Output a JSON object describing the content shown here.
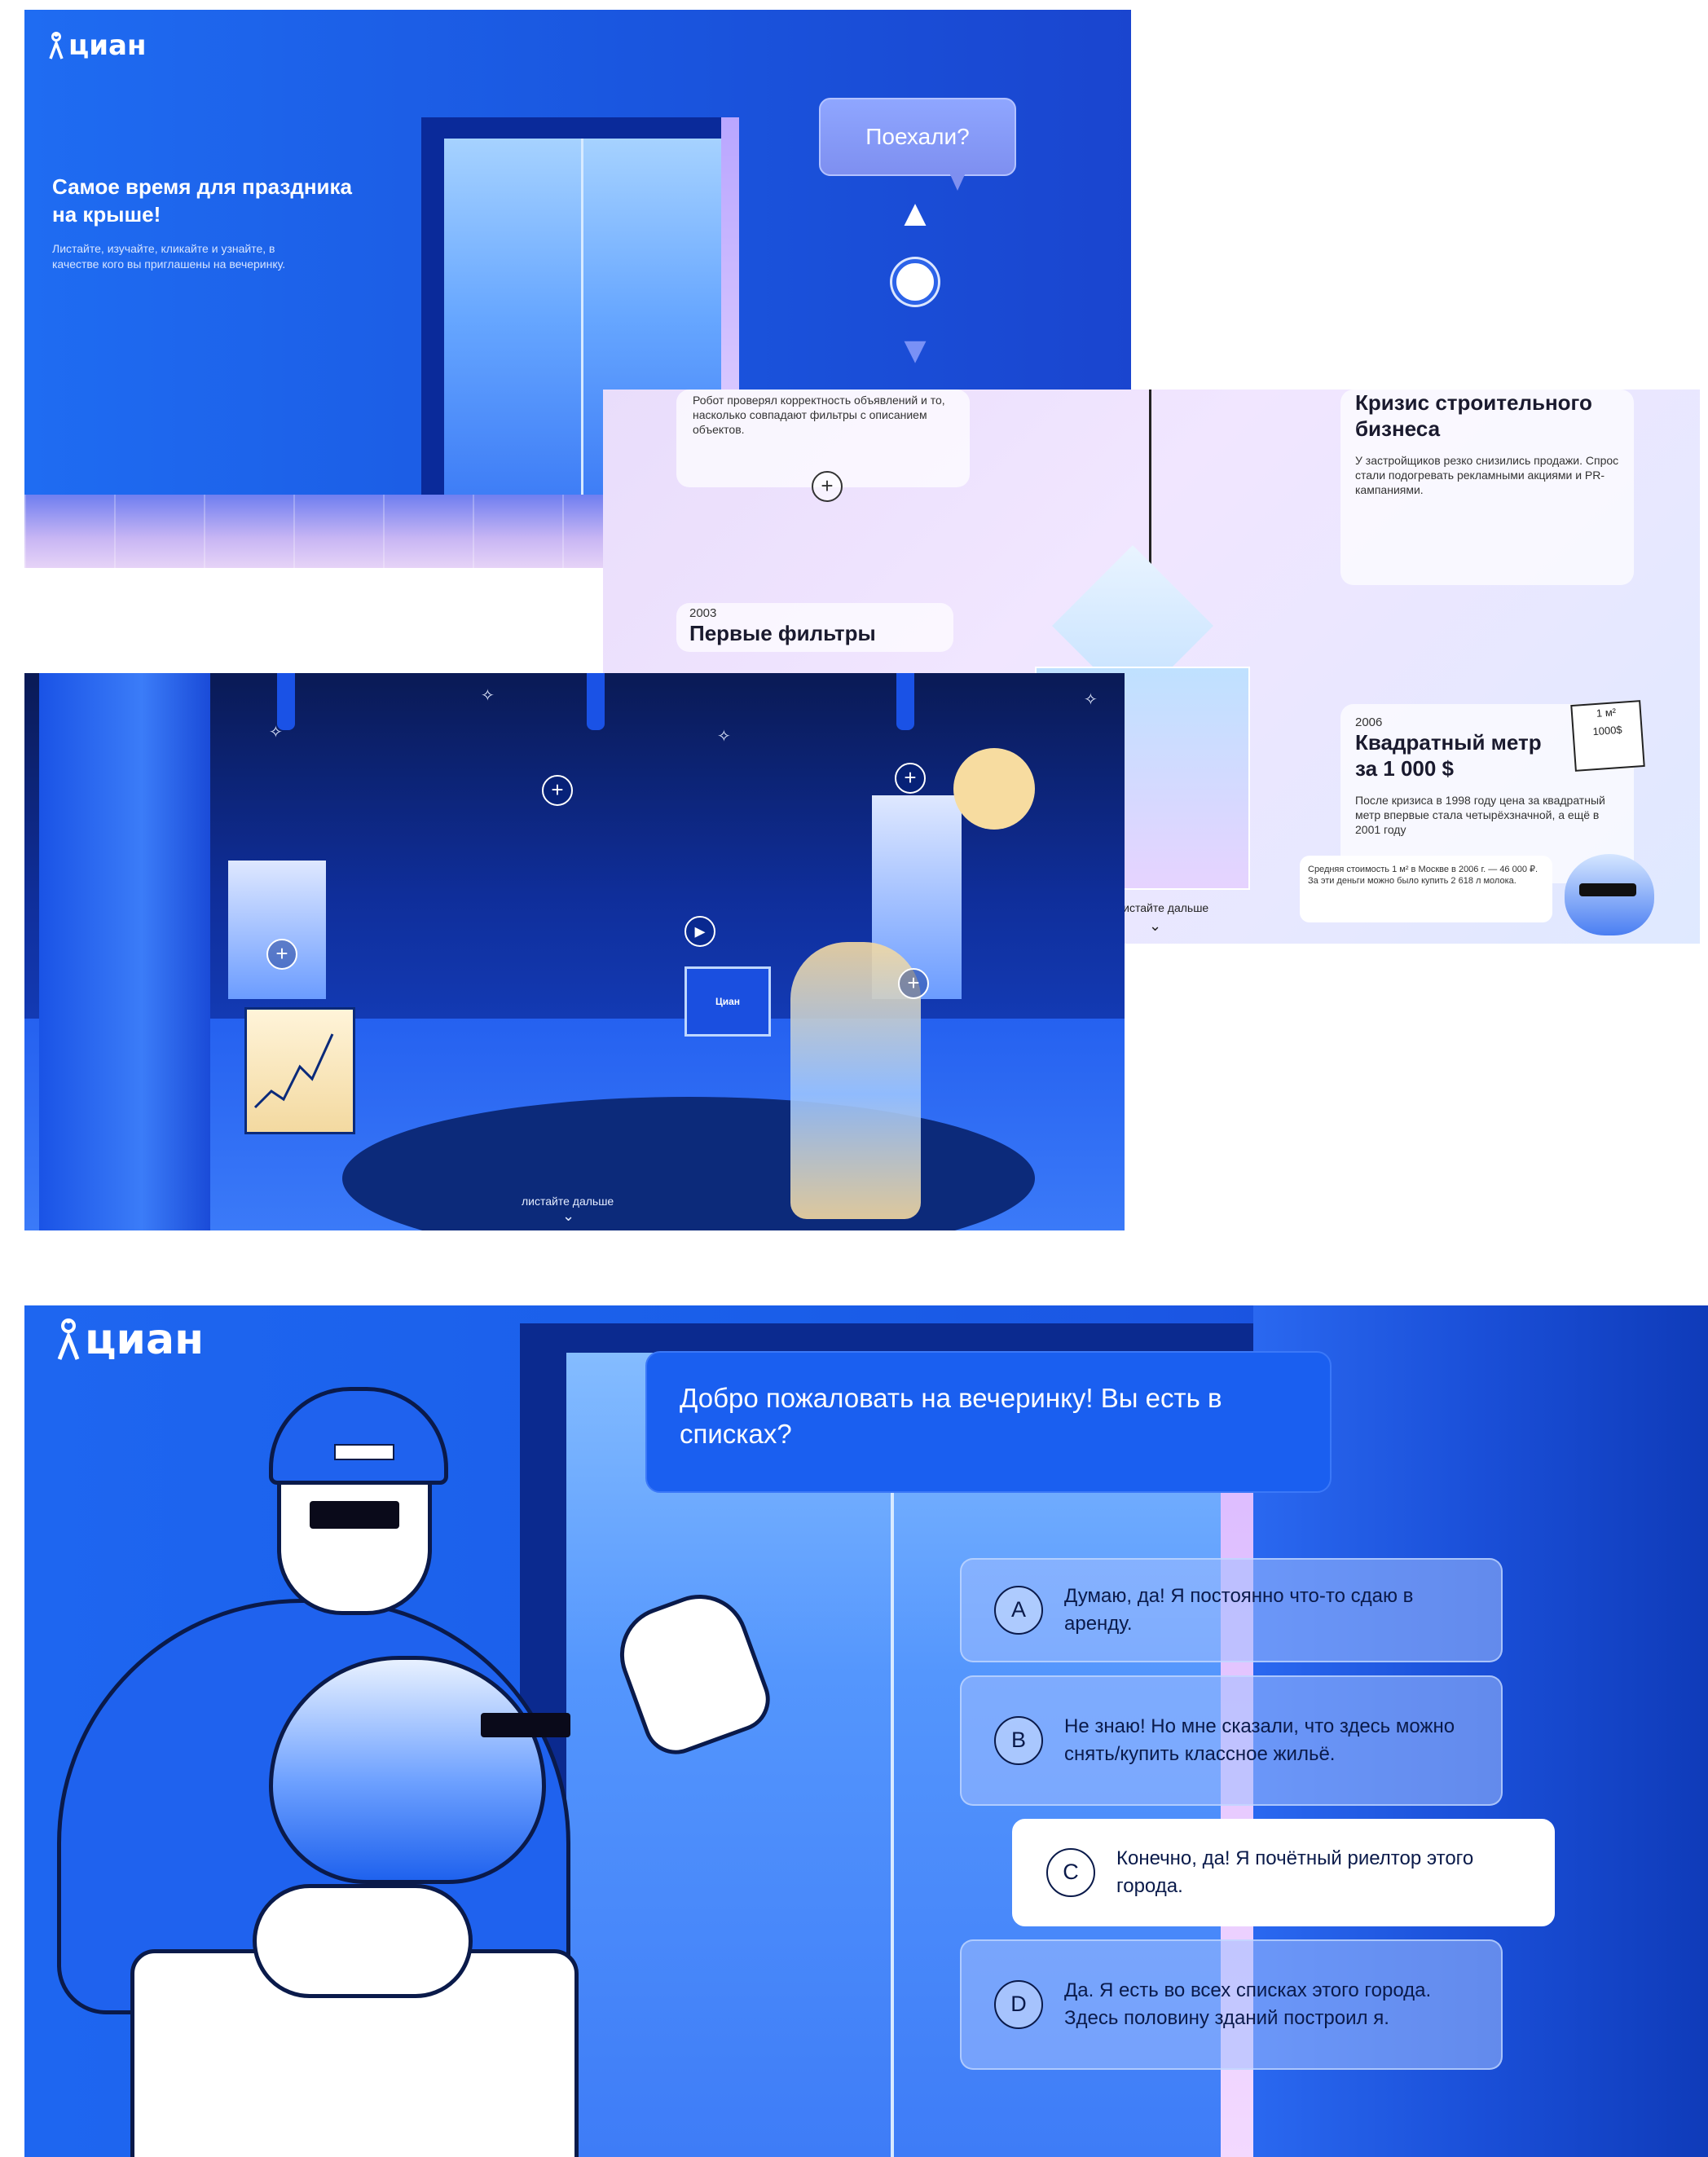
{
  "brand": {
    "logo_text": "циан"
  },
  "panel1": {
    "title": "Самое время для праздника на крыше!",
    "description": "Листайте, изучайте, кликайте и узнайте, в качестве кого вы приглашены на вечеринку.",
    "bubble": "Поехали?",
    "controls": {
      "up": "▲",
      "down": "▼"
    }
  },
  "panel2": {
    "card_robot": {
      "text": "Робот проверял корректность объявлений и то, насколько совпадают фильтры с описанием объектов."
    },
    "card_filters": {
      "year": "2003",
      "title": "Первые фильтры"
    },
    "card_crisis": {
      "title": "Кризис строительного бизнеса",
      "text": "У застройщиков резко снизились продажи. Спрос стали подогревать рекламными акциями и PR-кампаниями."
    },
    "card_meter": {
      "year": "2006",
      "title": "Квадратный метр за 1 000 $",
      "text": "После кризиса в 1998 году цена за квадратный метр впервые стала четырёхзначной, а ещё в 2001 году"
    },
    "note": "Средняя стоимость 1 м² в Москве в 2006 г. — 46 000 ₽. За эти деньги можно было купить 2 618 л молока.",
    "sticker": {
      "line1": "1 м²",
      "line2": "1000$"
    },
    "scroll_hint": "листайте дальше"
  },
  "panel3": {
    "monitor_label": "Циан",
    "scroll_hint": "листайте дальше"
  },
  "panel4": {
    "question": "Добро пожаловать на вечеринку! Вы есть в списках?",
    "options": [
      {
        "letter": "A",
        "text": "Думаю, да! Я постоянно что-то сдаю в аренду."
      },
      {
        "letter": "B",
        "text": "Не знаю! Но мне сказали, что здесь можно снять/купить классное жильё."
      },
      {
        "letter": "C",
        "text": "Конечно, да! Я почётный риелтор этого города."
      },
      {
        "letter": "D",
        "text": "Да. Я есть во всех списках этого города. Здесь половину зданий построил я."
      }
    ],
    "selected_option": "C"
  },
  "colors": {
    "brand_blue": "#1e66f0",
    "dark_navy": "#0a1a4a",
    "lavender": "#e9ddfb"
  }
}
